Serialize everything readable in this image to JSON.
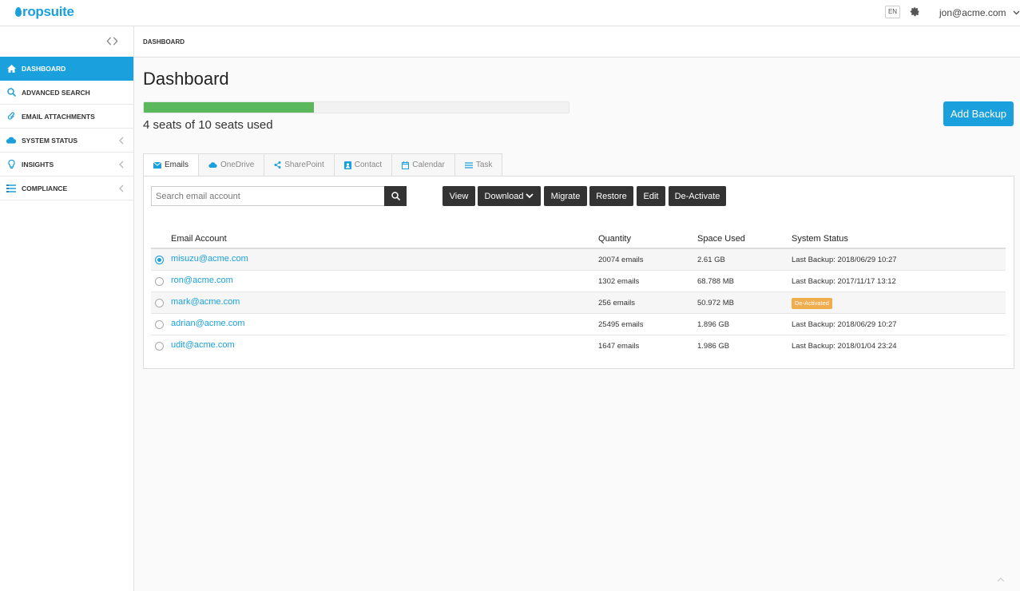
{
  "app": {
    "logo_text": "ropsuite",
    "brand_color": "#1aa0dc"
  },
  "topbar": {
    "lang": "EN",
    "user_email": "jon@acme.com"
  },
  "sidebar": {
    "items": [
      {
        "label": "Dashboard",
        "icon": "home-icon",
        "active": true
      },
      {
        "label": "Advanced Search",
        "icon": "search-icon"
      },
      {
        "label": "Email Attachments",
        "icon": "paperclip-icon"
      },
      {
        "label": "System Status",
        "icon": "cloud-icon"
      },
      {
        "label": "Insights",
        "icon": "lightbulb-icon"
      },
      {
        "label": "Compliance",
        "icon": "list-icon"
      }
    ]
  },
  "breadcrumb": "Dashboard",
  "main": {
    "title": "Dashboard",
    "seats_text": "4 seats of 10 seats used",
    "seats_used_fraction": 0.4,
    "add_backup_label": "Add Backup"
  },
  "tabs": [
    {
      "label": "Emails",
      "icon": "envelope-icon"
    },
    {
      "label": "OneDrive",
      "icon": "cloud-icon"
    },
    {
      "label": "SharePoint",
      "icon": "share-icon"
    },
    {
      "label": "Contact",
      "icon": "contact-icon"
    },
    {
      "label": "Calendar",
      "icon": "calendar-icon"
    },
    {
      "label": "Task",
      "icon": "task-icon"
    }
  ],
  "toolbar": {
    "search_placeholder": "Search email account",
    "view_label": "View",
    "download_label": "Download",
    "migrate_label": "Migrate",
    "restore_label": "Restore",
    "edit_label": "Edit",
    "deactivate_label": "De-Activate"
  },
  "table": {
    "headers": {
      "account": "Email Account",
      "quantity": "Quantity",
      "space": "Space Used",
      "status": "System Status"
    },
    "rows": [
      {
        "email": "misuzu@acme.com",
        "quantity": "20074 emails",
        "space": "2.61 GB",
        "status": "Last Backup: 2018/06/29 10:27"
      },
      {
        "email": "ron@acme.com",
        "quantity": "1302 emails",
        "space": "68.788 MB",
        "status": "Last Backup: 2017/11/17 13:12"
      },
      {
        "email": "mark@acme.com",
        "quantity": "256 emails",
        "space": "50.972 MB",
        "status": "De-Activated"
      },
      {
        "email": "adrian@acme.com",
        "quantity": "25495 emails",
        "space": "1.896 GB",
        "status": "Last Backup: 2018/06/29 10:27"
      },
      {
        "email": "udit@acme.com",
        "quantity": "1647 emails",
        "space": "1.986 GB",
        "status": "Last Backup: 2018/01/04 23:24"
      }
    ]
  }
}
